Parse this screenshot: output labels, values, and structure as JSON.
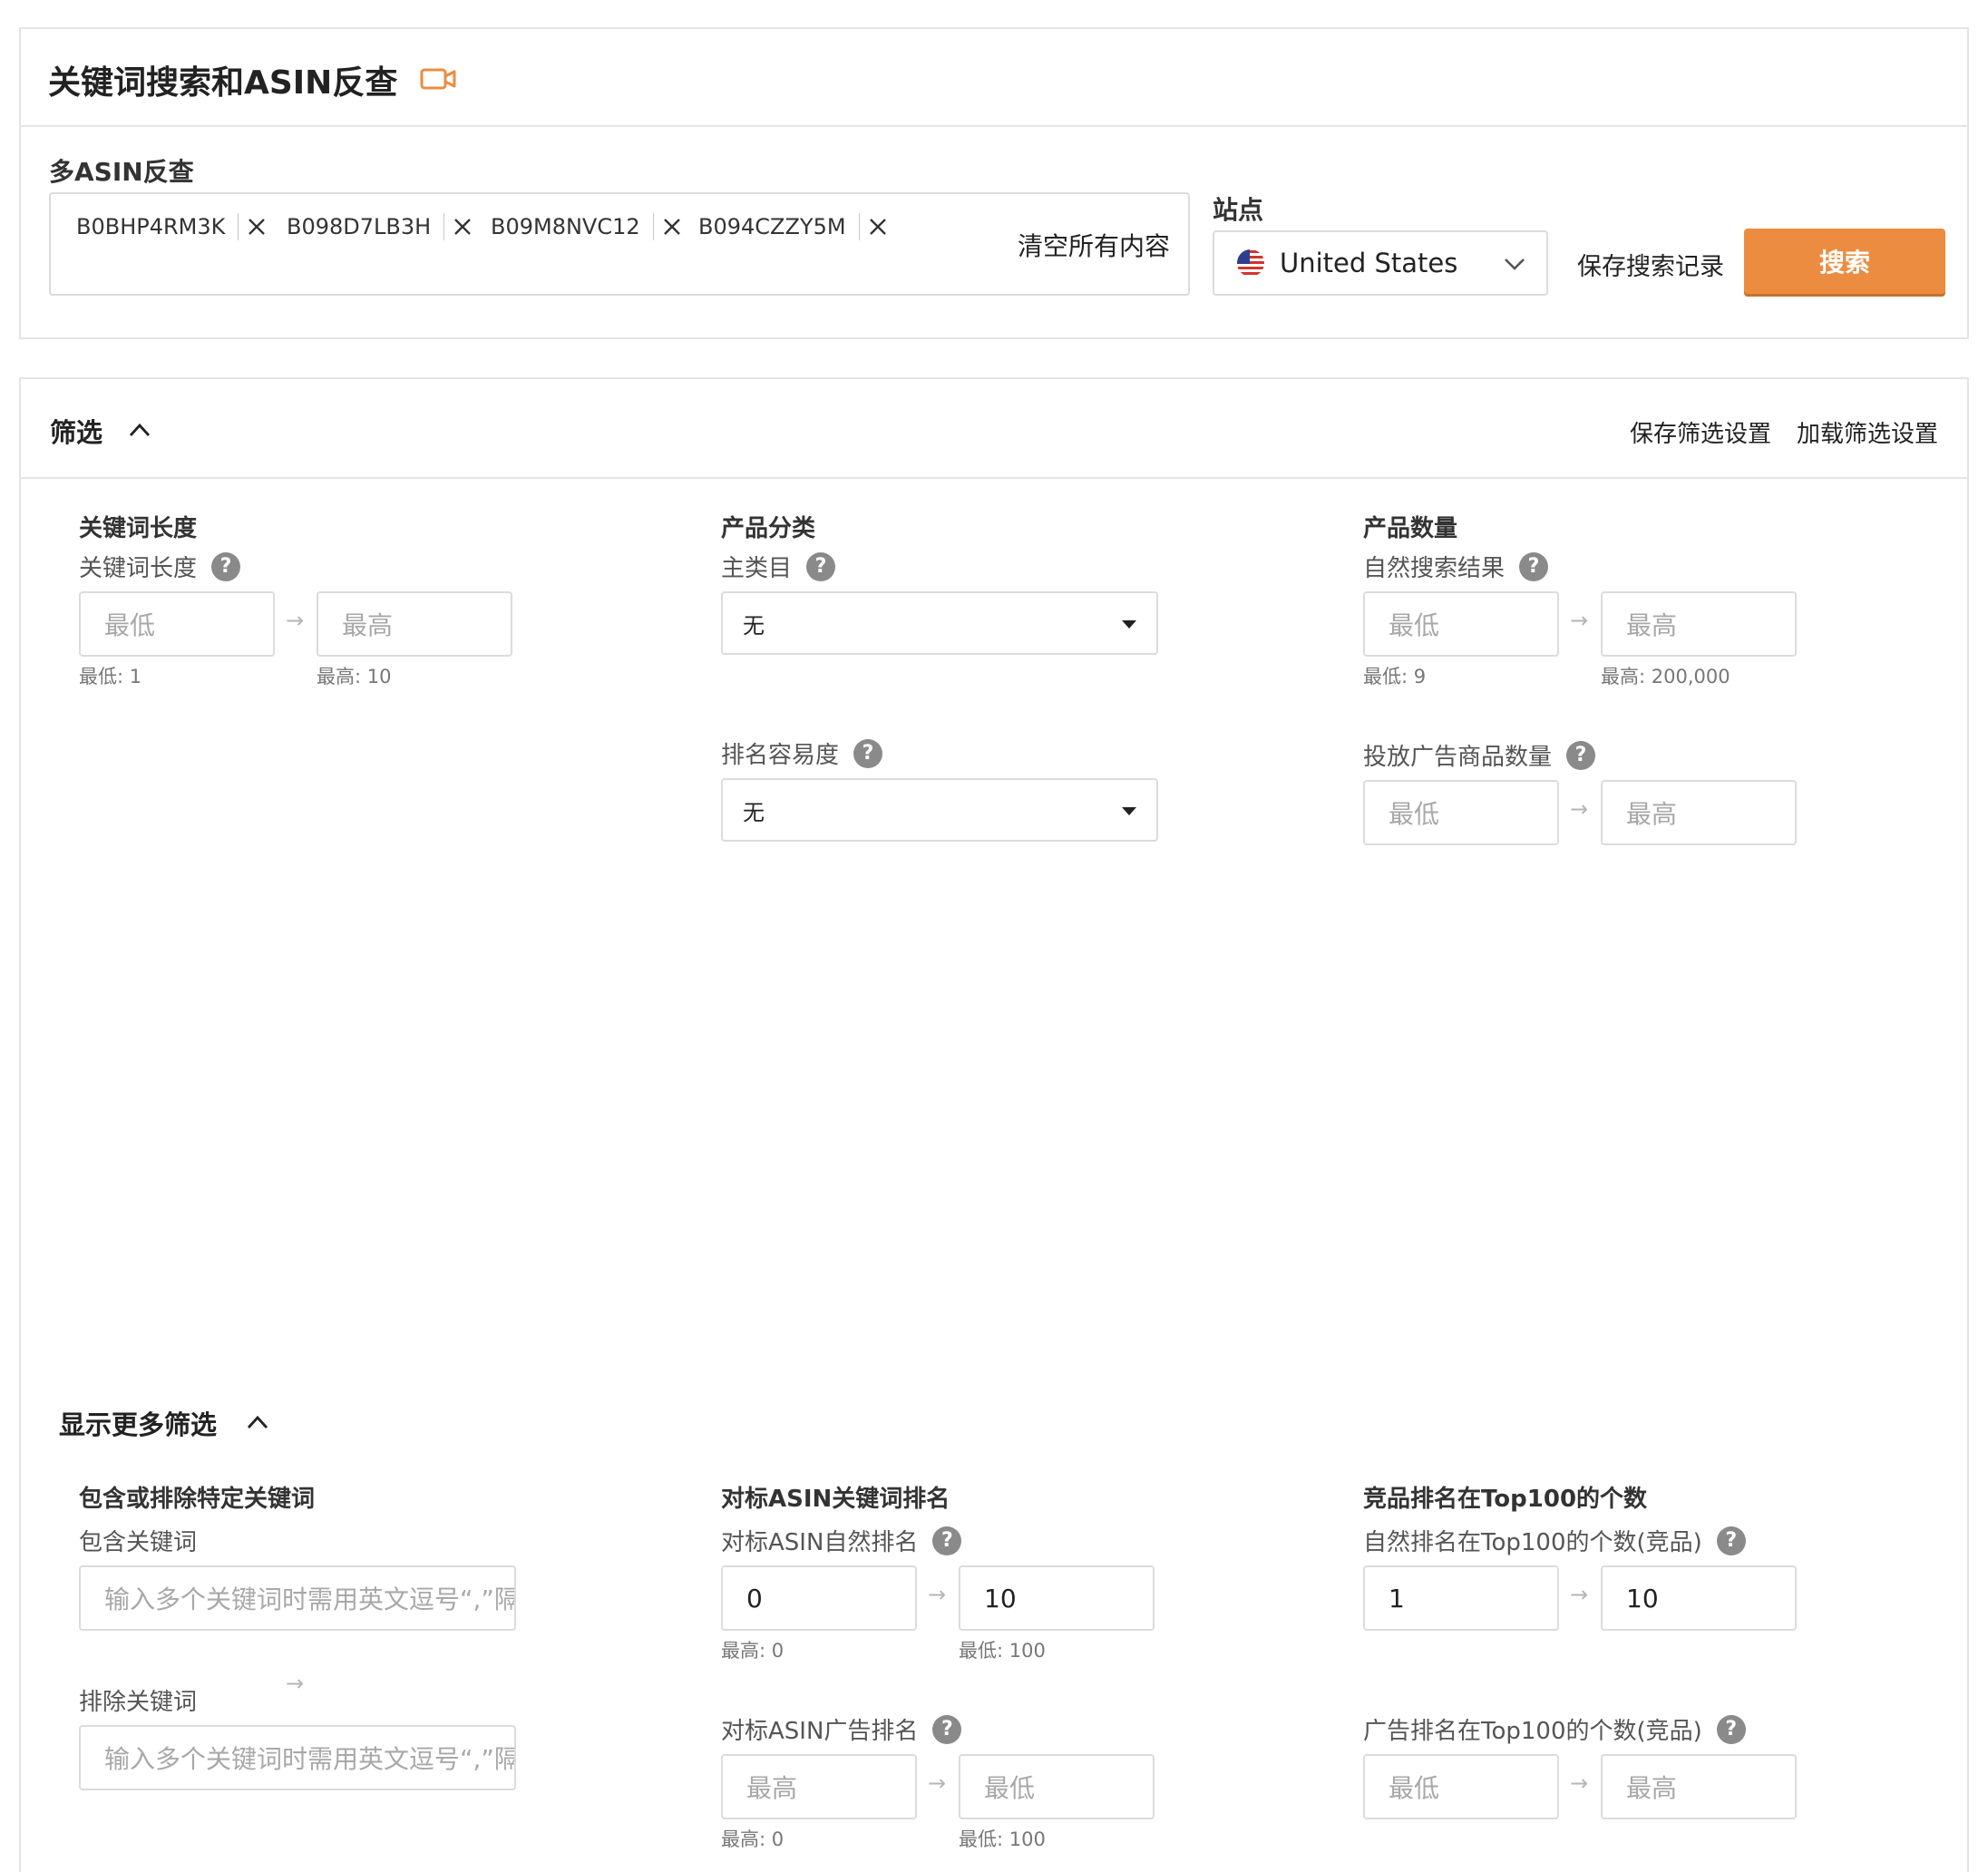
{
  "header": {
    "title": "关键词搜索和ASIN反查",
    "video_icon": "video-camera-icon",
    "accent_color": "#ec8c40"
  },
  "asin_search": {
    "label": "多ASIN反查",
    "tags": [
      "B0BHP4RM3K",
      "B098D7LB3H",
      "B09M8NVC12",
      "B094CZZY5M"
    ],
    "clear_all": "清空所有内容"
  },
  "site": {
    "label": "站点",
    "selected": "United States",
    "flag_icon": "us-flag-icon"
  },
  "actions": {
    "save_record": "保存搜索记录",
    "search": "搜索"
  },
  "filter": {
    "title": "筛选",
    "save_filter": "保存筛选设置",
    "load_filter": "加载筛选设置",
    "keyword_length": {
      "group": "关键词长度",
      "label": "关键词长度",
      "min_placeholder": "最低",
      "max_placeholder": "最高",
      "min_hint": "最低: 1",
      "max_hint": "最高: 10"
    },
    "category": {
      "group": "产品分类",
      "label": "主类目",
      "value": "无"
    },
    "rank_ease": {
      "label": "排名容易度",
      "value": "无"
    },
    "product_count": {
      "group": "产品数量",
      "label": "自然搜索结果",
      "min_placeholder": "最低",
      "max_placeholder": "最高",
      "min_hint": "最低: 9",
      "max_hint": "最高: 200,000"
    },
    "ad_products": {
      "label": "投放广告商品数量",
      "min_placeholder": "最低",
      "max_placeholder": "最高"
    }
  },
  "more_filter": {
    "title": "显示更多筛选",
    "include_exclude": {
      "group": "包含或排除特定关键词",
      "include_label": "包含关键词",
      "include_placeholder": "输入多个关键词时需用英文逗号“,”隔开",
      "exclude_label": "排除关键词",
      "exclude_placeholder": "输入多个关键词时需用英文逗号“,”隔开"
    },
    "asin_rank": {
      "group": "对标ASIN关键词排名",
      "organic_label": "对标ASIN自然排名",
      "organic_min": "0",
      "organic_max": "10",
      "organic_min_hint": "最高: 0",
      "organic_max_hint": "最低: 100",
      "ad_label": "对标ASIN广告排名",
      "ad_min_placeholder": "最高",
      "ad_max_placeholder": "最低",
      "ad_min_hint": "最高: 0",
      "ad_max_hint": "最低: 100"
    },
    "top100": {
      "group": "竞品排名在Top100的个数",
      "organic_label": "自然排名在Top100的个数(竞品)",
      "organic_min": "1",
      "organic_max": "10",
      "ad_label": "广告排名在Top100的个数(竞品)",
      "ad_min_placeholder": "最低",
      "ad_max_placeholder": "最高"
    }
  }
}
